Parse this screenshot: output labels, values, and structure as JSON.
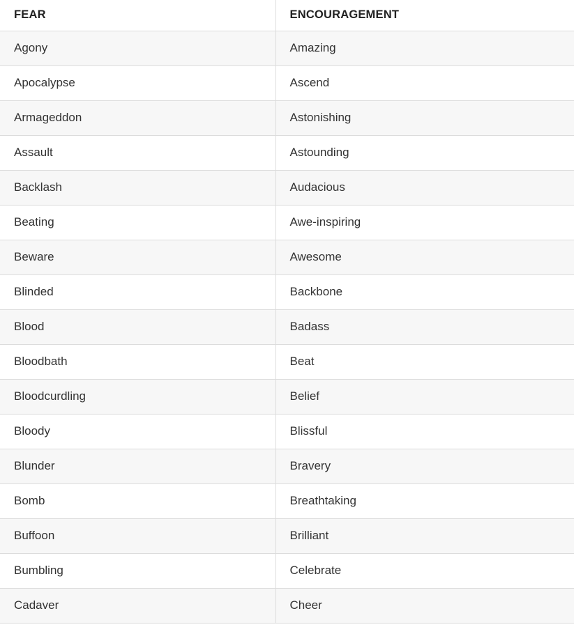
{
  "table": {
    "columns": [
      {
        "key": "fear",
        "header": "FEAR"
      },
      {
        "key": "encouragement",
        "header": "ENCOURAGEMENT"
      }
    ],
    "rows": [
      {
        "fear": "Agony",
        "encouragement": "Amazing"
      },
      {
        "fear": "Apocalypse",
        "encouragement": "Ascend"
      },
      {
        "fear": "Armageddon",
        "encouragement": "Astonishing"
      },
      {
        "fear": "Assault",
        "encouragement": "Astounding"
      },
      {
        "fear": "Backlash",
        "encouragement": "Audacious"
      },
      {
        "fear": "Beating",
        "encouragement": "Awe-inspiring"
      },
      {
        "fear": "Beware",
        "encouragement": "Awesome"
      },
      {
        "fear": "Blinded",
        "encouragement": "Backbone"
      },
      {
        "fear": "Blood",
        "encouragement": "Badass"
      },
      {
        "fear": "Bloodbath",
        "encouragement": "Beat"
      },
      {
        "fear": "Bloodcurdling",
        "encouragement": "Belief"
      },
      {
        "fear": "Bloody",
        "encouragement": "Blissful"
      },
      {
        "fear": "Blunder",
        "encouragement": "Bravery"
      },
      {
        "fear": "Bomb",
        "encouragement": "Breathtaking"
      },
      {
        "fear": "Buffoon",
        "encouragement": "Brilliant"
      },
      {
        "fear": "Bumbling",
        "encouragement": "Celebrate"
      },
      {
        "fear": "Cadaver",
        "encouragement": "Cheer"
      }
    ]
  },
  "colors": {
    "row_stripe": "#f7f7f7",
    "row_base": "#ffffff",
    "border": "#dcdcdc",
    "header_text": "#222222",
    "body_text": "#333333"
  }
}
